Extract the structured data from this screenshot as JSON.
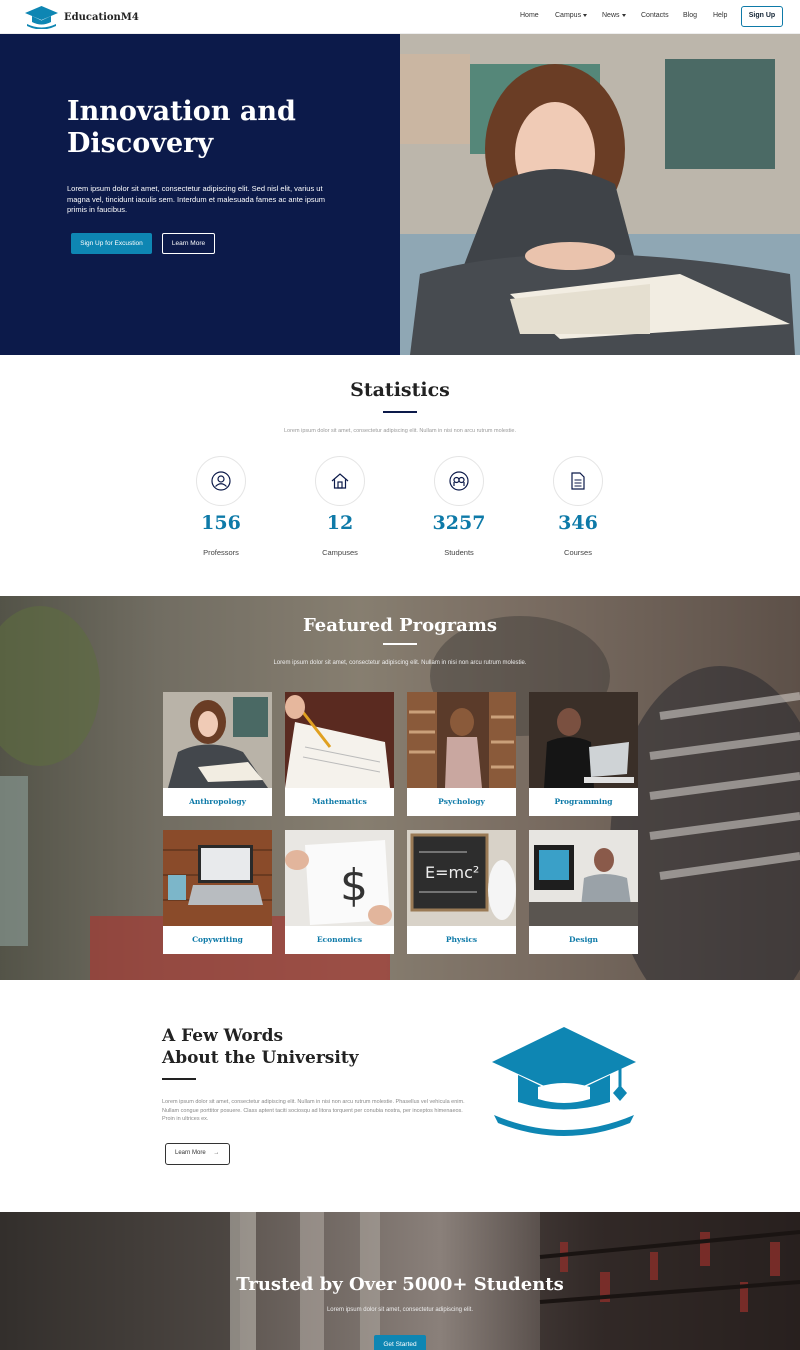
{
  "nav": {
    "brand": "EducationM4",
    "items": [
      {
        "label": "Home",
        "dropdown": false
      },
      {
        "label": "Campus",
        "dropdown": true
      },
      {
        "label": "News",
        "dropdown": true
      },
      {
        "label": "Contacts",
        "dropdown": false
      },
      {
        "label": "Blog",
        "dropdown": false
      },
      {
        "label": "Help",
        "dropdown": false
      }
    ],
    "signup": "Sign Up"
  },
  "hero": {
    "title_line1": "Innovation and",
    "title_line2": "Discovery",
    "text": "Lorem ipsum dolor sit amet, consectetur adipiscing elit. Sed nisl elit, varius ut magna vel, tincidunt iaculis sem. Interdum et malesuada fames ac ante ipsum primis in faucibus.",
    "primary_button": "Sign Up for Excustion",
    "secondary_button": "Learn More"
  },
  "statistics": {
    "title": "Statistics",
    "subtitle": "Lorem ipsum dolor sit amet, consectetur adipiscing elit. Nullam in nisi non arcu rutrum molestie.",
    "items": [
      {
        "value": "156",
        "label": "Professors",
        "icon": "user-icon"
      },
      {
        "value": "12",
        "label": "Campuses",
        "icon": "home-icon"
      },
      {
        "value": "3257",
        "label": "Students",
        "icon": "students-icon"
      },
      {
        "value": "346",
        "label": "Courses",
        "icon": "document-icon"
      }
    ]
  },
  "programs": {
    "title": "Featured Programs",
    "subtitle": "Lorem ipsum dolor sit amet, consectetur adipiscing elit. Nullam in nisi non arcu rutrum molestie.",
    "items": [
      "Anthropology",
      "Mathematics",
      "Psychology",
      "Programming",
      "Copywriting",
      "Economics",
      "Physics",
      "Design"
    ]
  },
  "about": {
    "title_line1": "A Few Words",
    "title_line2": "About the University",
    "text": "Lorem ipsum dolor sit amet, consectetur adipiscing elit. Nullam in nisi non arcu rutrum molestie. Phasellus vel vehicula enim. Nullam congue porttitor posuere. Class aptent taciti sociosqu ad litora torquent per conubia nostra, per inceptos himenaeos. Proin in ultrices ex.",
    "button": "Learn More"
  },
  "trusted": {
    "title": "Trusted by Over 5000+ Students",
    "subtitle": "Lorem ipsum dolor sit amet, consectetur adipiscing elit.",
    "button": "Get Started"
  },
  "colors": {
    "accent": "#0e86b3",
    "navy": "#0c1a4a"
  }
}
